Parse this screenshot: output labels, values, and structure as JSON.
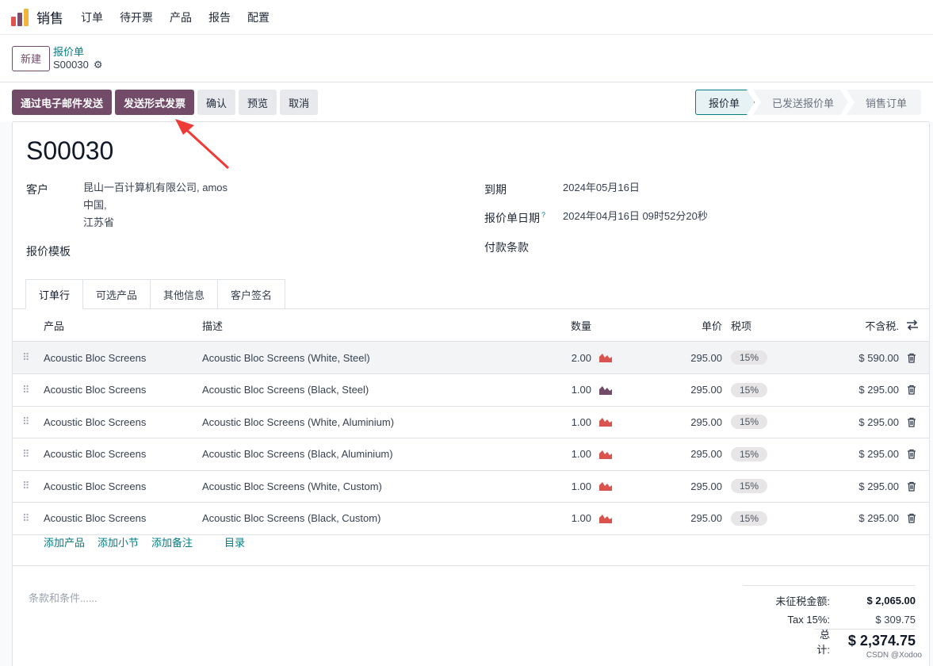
{
  "nav": {
    "app_name": "销售",
    "menu": [
      "订单",
      "待开票",
      "产品",
      "报告",
      "配置"
    ]
  },
  "control": {
    "new_label": "新建",
    "breadcrumb_parent": "报价单",
    "breadcrumb_current": "S00030"
  },
  "actions": {
    "send_email": "通过电子邮件发送",
    "send_proforma": "发送形式发票",
    "confirm": "确认",
    "preview": "预览",
    "cancel": "取消",
    "stages": [
      "报价单",
      "已发送报价单",
      "销售订单"
    ],
    "active_stage": "报价单"
  },
  "form": {
    "name": "S00030",
    "customer_label": "客户",
    "customer_name": "昆山一百计算机有限公司, amos",
    "customer_country": "中国,",
    "customer_state": "江苏省",
    "template_label": "报价模板",
    "expiration_label": "到期",
    "expiration_value": "2024年05月16日",
    "quote_date_label": "报价单日期",
    "quote_date_help": "?",
    "quote_date_value": "2024年04月16日 09时52分20秒",
    "payment_terms_label": "付款条款"
  },
  "tabs": [
    "订单行",
    "可选产品",
    "其他信息",
    "客户签名"
  ],
  "table": {
    "headers": {
      "product": "产品",
      "description": "描述",
      "quantity": "数量",
      "unit_price": "单价",
      "taxes": "税项",
      "subtotal": "不含税."
    },
    "rows": [
      {
        "product": "Acoustic Bloc Screens",
        "description": "Acoustic Bloc Screens (White, Steel)",
        "qty": "2.00",
        "price": "295.00",
        "tax": "15%",
        "subtotal": "$ 590.00",
        "forecast_color": "#d9534f"
      },
      {
        "product": "Acoustic Bloc Screens",
        "description": "Acoustic Bloc Screens (Black, Steel)",
        "qty": "1.00",
        "price": "295.00",
        "tax": "15%",
        "subtotal": "$ 295.00",
        "forecast_color": "#714b67"
      },
      {
        "product": "Acoustic Bloc Screens",
        "description": "Acoustic Bloc Screens (White, Aluminium)",
        "qty": "1.00",
        "price": "295.00",
        "tax": "15%",
        "subtotal": "$ 295.00",
        "forecast_color": "#d9534f"
      },
      {
        "product": "Acoustic Bloc Screens",
        "description": "Acoustic Bloc Screens (Black, Aluminium)",
        "qty": "1.00",
        "price": "295.00",
        "tax": "15%",
        "subtotal": "$ 295.00",
        "forecast_color": "#d9534f"
      },
      {
        "product": "Acoustic Bloc Screens",
        "description": "Acoustic Bloc Screens (White, Custom)",
        "qty": "1.00",
        "price": "295.00",
        "tax": "15%",
        "subtotal": "$ 295.00",
        "forecast_color": "#d9534f"
      },
      {
        "product": "Acoustic Bloc Screens",
        "description": "Acoustic Bloc Screens (Black, Custom)",
        "qty": "1.00",
        "price": "295.00",
        "tax": "15%",
        "subtotal": "$ 295.00",
        "forecast_color": "#d9534f"
      }
    ],
    "add_product": "添加产品",
    "add_section": "添加小节",
    "add_note": "添加备注",
    "catalog": "目录"
  },
  "footer": {
    "terms_placeholder": "条款和条件......",
    "untaxed_label": "未征税金额:",
    "untaxed_value": "$ 2,065.00",
    "tax_label": "Tax 15%:",
    "tax_value": "$ 309.75",
    "total_label": "总计:",
    "total_value": "$ 2,374.75"
  },
  "watermark": "CSDN @Xodoo",
  "colors": {
    "primary": "#714b67",
    "link": "#017e84",
    "annotation_arrow": "#ef3b36"
  }
}
